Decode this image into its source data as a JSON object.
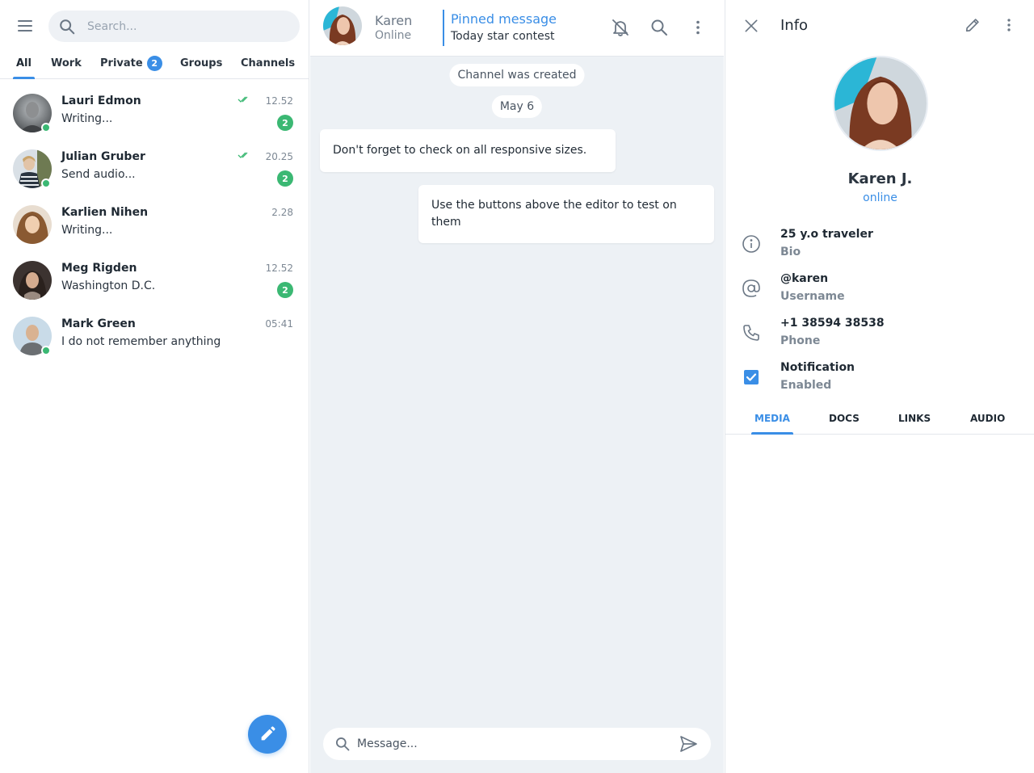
{
  "sidebar": {
    "search_placeholder": "Search...",
    "tabs": [
      {
        "label": "All",
        "active": true
      },
      {
        "label": "Work"
      },
      {
        "label": "Private",
        "badge": "2"
      },
      {
        "label": "Groups"
      },
      {
        "label": "Channels"
      }
    ],
    "chats": [
      {
        "name": "Lauri Edmon",
        "preview": "Writing...",
        "time": "12.52",
        "read": true,
        "unread": "2",
        "online": true
      },
      {
        "name": "Julian Gruber",
        "preview": "Send audio...",
        "time": "20.25",
        "read": true,
        "unread": "2",
        "online": true
      },
      {
        "name": "Karlien Nihen",
        "preview": "Writing...",
        "time": "2.28",
        "read": false,
        "unread": null,
        "online": false
      },
      {
        "name": "Meg Rigden",
        "preview": "Washington D.C.",
        "time": "12.52",
        "read": false,
        "unread": "2",
        "online": false
      },
      {
        "name": "Mark Green",
        "preview": "I do not remember anything",
        "time": "05:41",
        "read": false,
        "unread": null,
        "online": true
      }
    ],
    "fab_icon": "pencil-icon"
  },
  "chat": {
    "header": {
      "name": "Karen",
      "status": "Online",
      "pinned_title": "Pinned message",
      "pinned_text": "Today star contest",
      "icons": [
        "bell-off-icon",
        "search-icon",
        "more-vertical-icon"
      ]
    },
    "system": {
      "created": "Channel was created",
      "date": "May 6"
    },
    "messages": [
      {
        "text": "Don't forget to check on all responsive sizes.",
        "side": "left"
      },
      {
        "text": "Use the buttons above the editor to test on them",
        "side": "right"
      }
    ],
    "composer_placeholder": "Message..."
  },
  "info": {
    "title": "Info",
    "name": "Karen J.",
    "status": "online",
    "rows": [
      {
        "icon": "info-icon",
        "value": "25 y.o traveler",
        "label": "Bio"
      },
      {
        "icon": "at-sign-icon",
        "value": "@karen",
        "label": "Username"
      },
      {
        "icon": "phone-icon",
        "value": "+1 38594 38538",
        "label": "Phone"
      },
      {
        "icon": "checkbox-checked-icon",
        "value": "Notification",
        "label": "Enabled"
      }
    ],
    "tabs": [
      {
        "label": "MEDIA",
        "active": true
      },
      {
        "label": "DOCS"
      },
      {
        "label": "LINKS"
      },
      {
        "label": "AUDIO"
      }
    ]
  },
  "colors": {
    "accent": "#3a8ee6",
    "online": "#3bb873",
    "chat_bg": "#edf1f5"
  }
}
